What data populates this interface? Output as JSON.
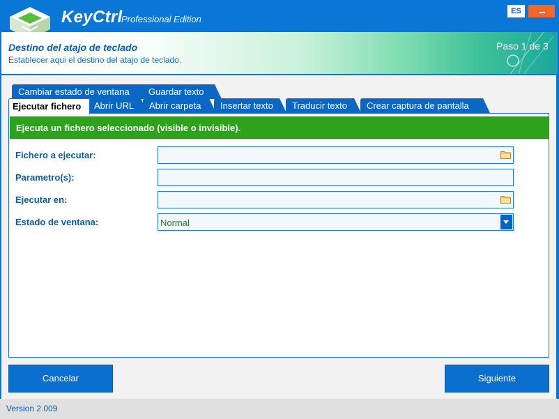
{
  "app": {
    "name": "KeyCtrl",
    "edition": "Professional Edition",
    "language": "ES"
  },
  "banner": {
    "title": "Destino del atajo de teclado",
    "subtitle": "Establecer aqui el destino del atajo de teclado.",
    "step": "Paso 1 de 3"
  },
  "tabs": {
    "row_back": [
      "Cambiar estado de ventana",
      "Guardar texto"
    ],
    "row_front": [
      "Ejecutar fichero",
      "Abrir URL",
      "Abrir carpeta",
      "Insertar texto",
      "Traducir texto",
      "Crear captura de pantalla"
    ],
    "active": "Ejecutar fichero"
  },
  "panel": {
    "header": "Ejecuta un fichero seleccionado (visible o invisible).",
    "fields": [
      {
        "label": "Fichero a ejecutar:",
        "value": "",
        "icon": "folder-icon"
      },
      {
        "label": "Parametro(s):",
        "value": ""
      },
      {
        "label": "Ejecutar en:",
        "value": "",
        "icon": "folder-icon"
      },
      {
        "label": "Estado de ventana:",
        "value": "Normal",
        "icon": "chevron-down-icon"
      }
    ]
  },
  "buttons": {
    "cancel": "Cancelar",
    "next": "Siguiente"
  },
  "status": {
    "version": "Version 2.009"
  },
  "colors": {
    "titlebar": "#0a77d6",
    "accent": "#0a6fcf",
    "header_green": "#2ea21d",
    "minimize": "#f2672c"
  }
}
